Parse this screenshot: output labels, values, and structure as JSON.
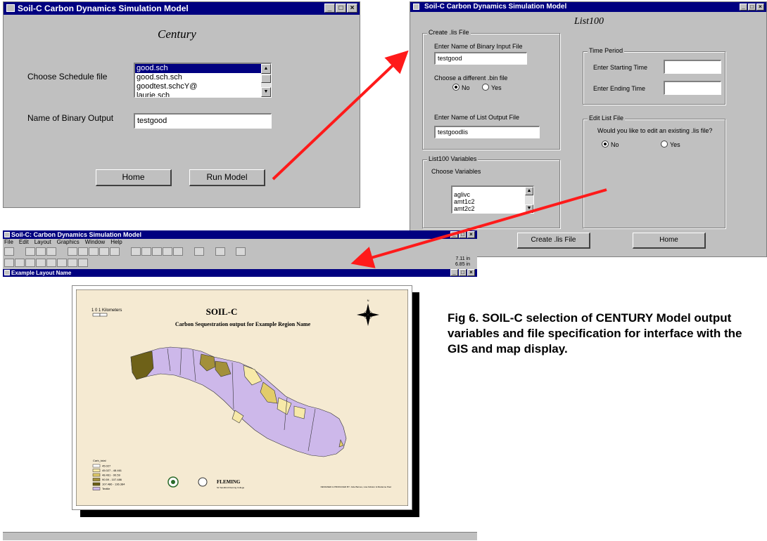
{
  "win1": {
    "title": "Soil-C Carbon Dynamics Simulation Model",
    "heading": "Century",
    "schedule_label": "Choose Schedule file",
    "schedule_files": [
      "good.sch",
      "good.sch.sch",
      "goodtest.schcY@",
      "laurie.sch"
    ],
    "binary_label": "Name of Binary Output",
    "binary_value": "testgood",
    "home_button": "Home",
    "run_button": "Run Model"
  },
  "win2": {
    "title": "Soil-C Carbon Dynamics Simulation Model",
    "heading": "List100",
    "create_group": "Create .lis File",
    "binary_input_label": "Enter Name of Binary Input File",
    "binary_input_value": "testgood",
    "bin_choice_label": "Choose a different .bin file",
    "no_label": "No",
    "yes_label": "Yes",
    "list_output_label": "Enter Name of List Output File",
    "list_output_value": "testgoodlis",
    "time_group": "Time Period",
    "start_label": "Enter Starting Time",
    "end_label": "Enter Ending Time",
    "edit_group": "Edit List File",
    "edit_question": "Would you like to edit an existing .lis file?",
    "vars_group": "List100 Variables",
    "vars_label": "Choose Variables",
    "variables": [
      "aglivc",
      "amt1c2",
      "amt2c2"
    ],
    "create_button": "Create .lis File",
    "home_button": "Home"
  },
  "gis": {
    "title": "Soil-C: Carbon Dynamics Simulation Model",
    "menu": [
      "File",
      "Edit",
      "Layout",
      "Graphics",
      "Window",
      "Help"
    ],
    "coords": [
      "7.11 in",
      "6.85 in"
    ],
    "layout_title": "Example Layout Name"
  },
  "map": {
    "title": "SOIL-C",
    "subtitle": "Carbon Sequestration output for Example Region Name",
    "scale_label": "1   0   1  Kilometers",
    "north": "N",
    "legend_title": "Carb_total",
    "legend": [
      {
        "label": "45.027",
        "color": "#ffffff"
      },
      {
        "label": "45.027 - 48.461",
        "color": "#f7e9a8"
      },
      {
        "label": "48.461 - 90.59",
        "color": "#e2cc6a"
      },
      {
        "label": "90.59 - 107.486",
        "color": "#a3903a"
      },
      {
        "label": "107.486 - 136.384",
        "color": "#6e6118"
      },
      {
        "label": "Textile",
        "color": "#cdb8ea"
      }
    ],
    "logo_text": "FLEMING",
    "logo_sub": "Sir Sandford Fleming College",
    "credits": "DESIGNED & PRODUCED BY: Julie Barnes, Lisa Kidston & Marianne Paul"
  },
  "caption": "Fig 6. SOIL-C selection of CENTURY Model output variables and file specification for interface with the GIS and map display."
}
